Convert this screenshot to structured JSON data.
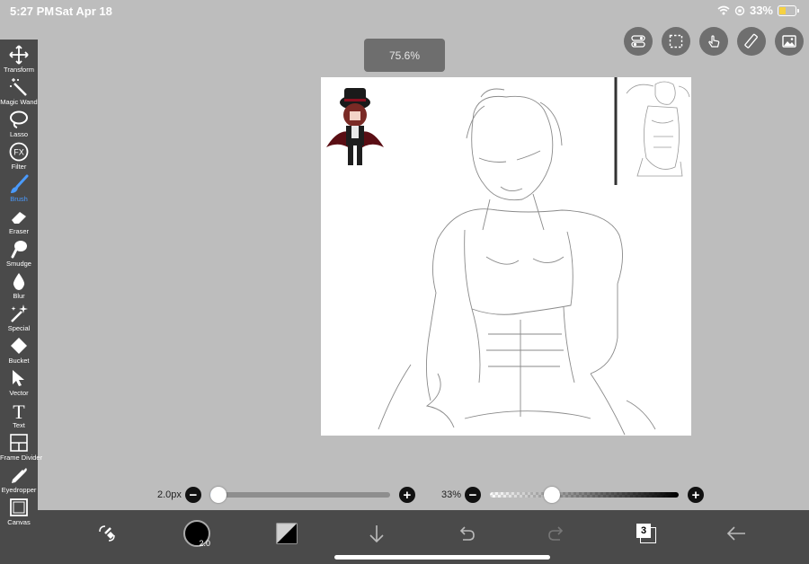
{
  "status": {
    "time": "5:27 PM",
    "date": "Sat Apr 18",
    "battery": "33%"
  },
  "tools": [
    {
      "label": "Transform",
      "icon": "transform-icon"
    },
    {
      "label": "Magic Wand",
      "icon": "magic-wand-icon"
    },
    {
      "label": "Lasso",
      "icon": "lasso-icon"
    },
    {
      "label": "Filter",
      "icon": "filter-fx-icon"
    },
    {
      "label": "Brush",
      "icon": "brush-icon",
      "active": true
    },
    {
      "label": "Eraser",
      "icon": "eraser-icon"
    },
    {
      "label": "Smudge",
      "icon": "smudge-icon"
    },
    {
      "label": "Blur",
      "icon": "blur-icon"
    },
    {
      "label": "Special",
      "icon": "special-icon"
    },
    {
      "label": "Bucket",
      "icon": "bucket-icon"
    },
    {
      "label": "Vector",
      "icon": "vector-icon"
    },
    {
      "label": "Text",
      "icon": "text-icon"
    },
    {
      "label": "Frame Divider",
      "icon": "frame-divider-icon"
    },
    {
      "label": "Eyedropper",
      "icon": "eyedropper-icon"
    },
    {
      "label": "Canvas",
      "icon": "canvas-icon"
    }
  ],
  "zoom": "75.6%",
  "filter_glyph": "FX",
  "text_glyph": "T",
  "brush": {
    "size_label": "2.0px",
    "size_fraction": 0.02
  },
  "opacity": {
    "label": "33%",
    "fraction": 0.33
  },
  "bottom": {
    "brush_size_badge": "2.0",
    "layer_count": "3"
  },
  "colors": {
    "accent": "#4a9bff",
    "toolbar": "#4a4a4a",
    "background": "#bdbdbd"
  }
}
